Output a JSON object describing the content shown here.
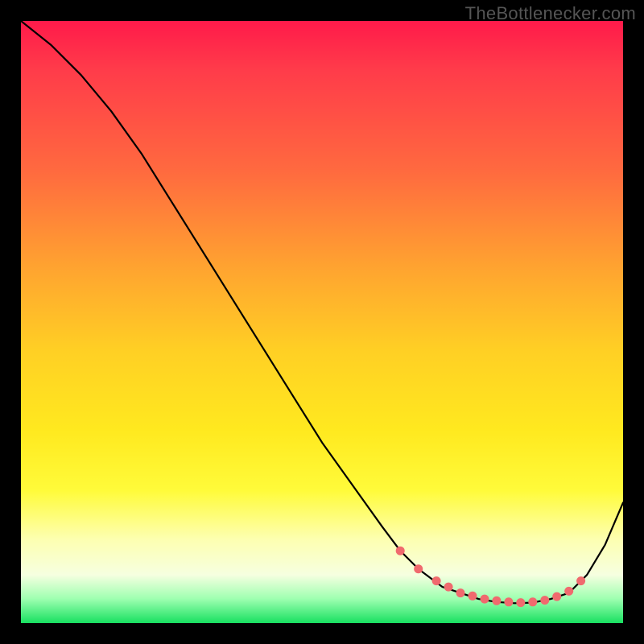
{
  "watermark": "TheBottlenecker.com",
  "chart_data": {
    "type": "line",
    "title": "",
    "xlabel": "",
    "ylabel": "",
    "xlim": [
      0,
      100
    ],
    "ylim": [
      0,
      100
    ],
    "series": [
      {
        "name": "curve",
        "x": [
          0,
          5,
          10,
          15,
          20,
          25,
          30,
          35,
          40,
          45,
          50,
          55,
          60,
          63,
          66,
          70,
          73,
          76,
          79,
          82,
          85,
          88,
          91,
          94,
          97,
          100
        ],
        "y": [
          100,
          96,
          91,
          85,
          78,
          70,
          62,
          54,
          46,
          38,
          30,
          23,
          16,
          12,
          9,
          6,
          5,
          4,
          3.5,
          3.3,
          3.4,
          4,
          5,
          8,
          13,
          20
        ]
      }
    ],
    "markers": {
      "name": "bottom-dots",
      "x": [
        63,
        66,
        69,
        71,
        73,
        75,
        77,
        79,
        81,
        83,
        85,
        87,
        89,
        91,
        93
      ],
      "y": [
        12,
        9,
        7,
        6,
        5,
        4.5,
        4,
        3.7,
        3.5,
        3.4,
        3.5,
        3.8,
        4.4,
        5.3,
        7
      ]
    }
  }
}
